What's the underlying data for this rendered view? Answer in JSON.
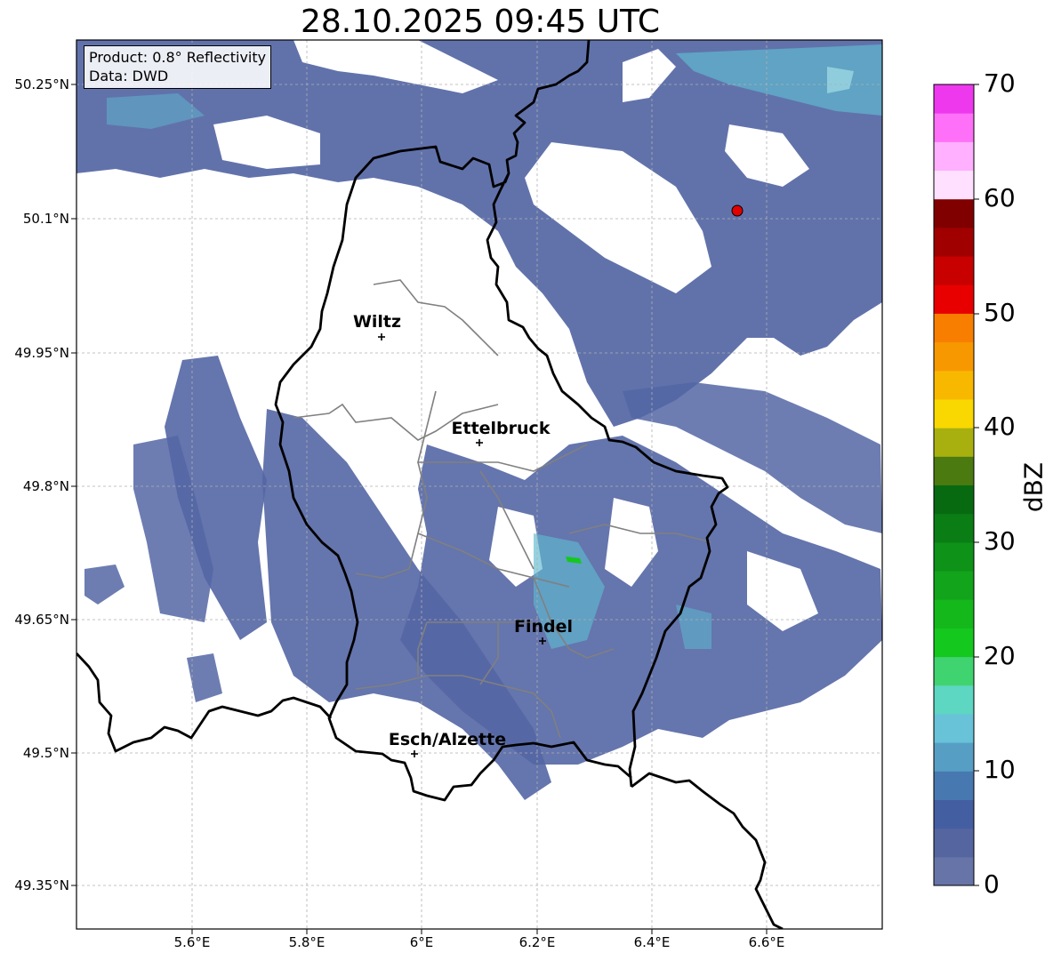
{
  "title": "28.10.2025 09:45 UTC",
  "info": {
    "product": "Product: 0.8° Reflectivity",
    "data": "Data: DWD"
  },
  "lat_ticks": [
    "50.25°N",
    "50.1°N",
    "49.95°N",
    "49.8°N",
    "49.65°N",
    "49.5°N",
    "49.35°N"
  ],
  "lon_ticks": [
    "5.6°E",
    "5.8°E",
    "6°E",
    "6.2°E",
    "6.4°E",
    "6.6°E"
  ],
  "cities": [
    {
      "name": "Wiltz"
    },
    {
      "name": "Ettelbruck"
    },
    {
      "name": "Findel"
    },
    {
      "name": "Esch/Alzette"
    }
  ],
  "radar_site_color": "#e00000",
  "colorbar": {
    "label": "dBZ",
    "ticks": [
      "0",
      "10",
      "20",
      "30",
      "40",
      "50",
      "60",
      "70"
    ],
    "min": 0,
    "max": 70,
    "step": 2.5,
    "colors": [
      "#6674a8",
      "#5565a0",
      "#445ea2",
      "#4878b0",
      "#579ec5",
      "#68c2d8",
      "#5dd6c2",
      "#3fd46f",
      "#14c81e",
      "#14b81a",
      "#12a41a",
      "#0e9218",
      "#0a7e14",
      "#086a10",
      "#4a7a10",
      "#a8b010",
      "#f8d800",
      "#f8b800",
      "#f89800",
      "#f87e00",
      "#e80000",
      "#c80000",
      "#a00000",
      "#800000",
      "#ffe0ff",
      "#ffb0ff",
      "#ff70f8",
      "#ee38ee"
    ]
  },
  "map": {
    "precip_color": "#5466a4",
    "light_color": "#5fb8cf",
    "border_color": "#000000",
    "canton_color": "#808080"
  }
}
